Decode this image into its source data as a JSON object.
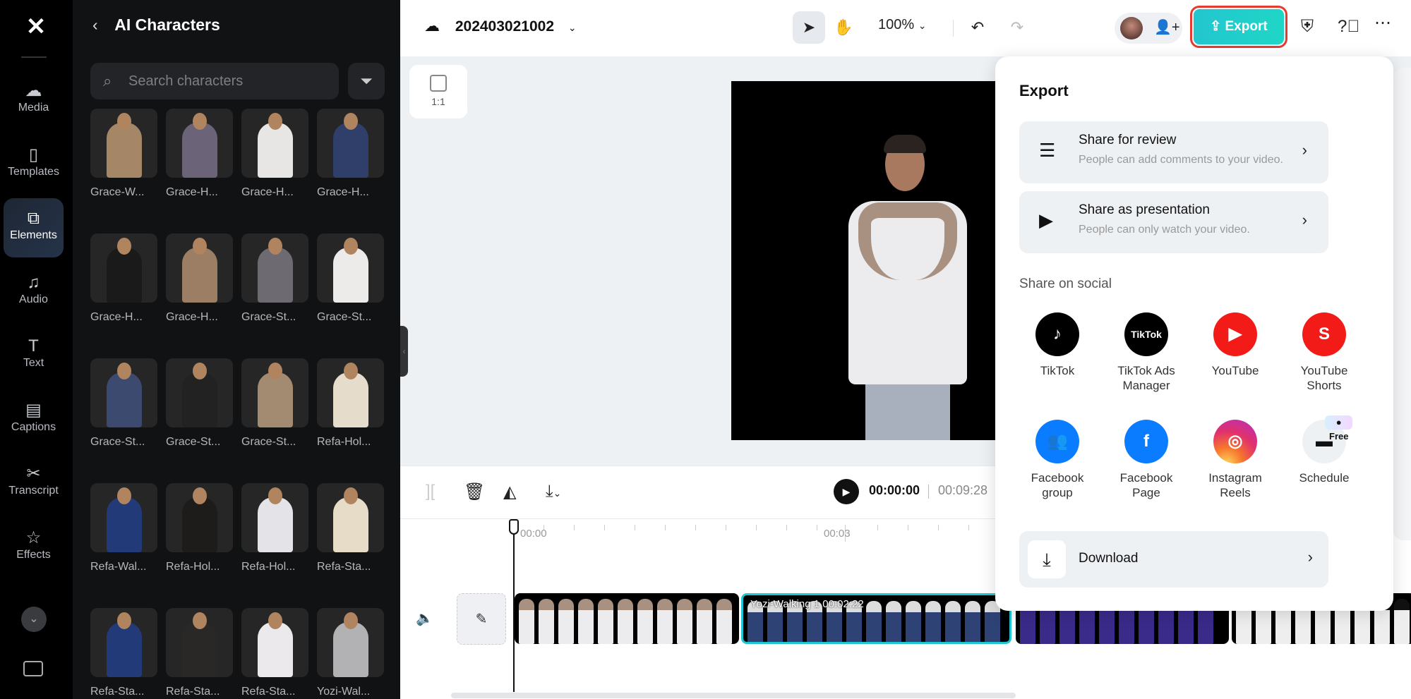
{
  "nav": {
    "logo": "capcut-logo",
    "items": [
      {
        "label": "Media",
        "icon": "cloud-upload-icon",
        "glyph": "☁",
        "active": false
      },
      {
        "label": "Templates",
        "icon": "templates-icon",
        "glyph": "▯",
        "active": false
      },
      {
        "label": "Elements",
        "icon": "elements-icon",
        "glyph": "⧉",
        "active": true
      },
      {
        "label": "Audio",
        "icon": "music-note-icon",
        "glyph": "♫",
        "active": false
      },
      {
        "label": "Text",
        "icon": "text-icon",
        "glyph": "T",
        "active": false
      },
      {
        "label": "Captions",
        "icon": "captions-icon",
        "glyph": "▤",
        "active": false
      },
      {
        "label": "Transcript",
        "icon": "transcript-icon",
        "glyph": "✂",
        "active": false
      },
      {
        "label": "Effects",
        "icon": "effects-star-icon",
        "glyph": "☆",
        "active": false
      }
    ],
    "more_glyph": "⌄"
  },
  "panel": {
    "back_glyph": "‹",
    "title": "AI Characters",
    "search_placeholder": "Search characters",
    "characters": [
      {
        "name": "Grace-W...",
        "color": "#a58768"
      },
      {
        "name": "Grace-H...",
        "color": "#6b6478"
      },
      {
        "name": "Grace-H...",
        "color": "#e8e6e4"
      },
      {
        "name": "Grace-H...",
        "color": "#2f3f6a"
      },
      {
        "name": "Grace-H...",
        "color": "#1a1a1a"
      },
      {
        "name": "Grace-H...",
        "color": "#9c7e64"
      },
      {
        "name": "Grace-St...",
        "color": "#6e6a72"
      },
      {
        "name": "Grace-St...",
        "color": "#ecebea"
      },
      {
        "name": "Grace-St...",
        "color": "#3d4a70"
      },
      {
        "name": "Grace-St...",
        "color": "#222222"
      },
      {
        "name": "Grace-St...",
        "color": "#a38b71"
      },
      {
        "name": "Refa-Hol...",
        "color": "#e6dccb"
      },
      {
        "name": "Refa-Wal...",
        "color": "#223a78"
      },
      {
        "name": "Refa-Hol...",
        "color": "#1e1c1b"
      },
      {
        "name": "Refa-Hol...",
        "color": "#e4e4e8"
      },
      {
        "name": "Refa-Sta...",
        "color": "#e7dcc8"
      },
      {
        "name": "Refa-Sta...",
        "color": "#223a78"
      },
      {
        "name": "Refa-Sta...",
        "color": "#2a2827"
      },
      {
        "name": "Refa-Sta...",
        "color": "#ebe9ec"
      },
      {
        "name": "Yozi-Wal...",
        "color": "#b2b2b4"
      }
    ]
  },
  "topbar": {
    "project_name": "202403021002",
    "zoom": "100%",
    "export_label": "Export",
    "export_color": "#22c6cf"
  },
  "canvas": {
    "ratio_label": "1:1"
  },
  "timeline": {
    "current_time": "00:00:00",
    "total_time": "00:09:28",
    "ruler_labels": [
      "00:00",
      "00:03"
    ],
    "clips": [
      {
        "label": "",
        "color": "#ecebee",
        "accent": "#a89180",
        "selected": false
      },
      {
        "label": "Yozi-Walking 1   00:02:22",
        "color": "#2e4276",
        "accent": "#ddd",
        "selected": true
      },
      {
        "label": "",
        "color": "#3a2a8a",
        "accent": "#333",
        "selected": false
      },
      {
        "label": "",
        "color": "#eeeeee",
        "accent": "#111",
        "selected": false
      }
    ]
  },
  "export_panel": {
    "title": "Export",
    "share_options": [
      {
        "title": "Share for review",
        "subtitle": "People can add comments to your video.",
        "icon": "comment-icon",
        "glyph": "☰"
      },
      {
        "title": "Share as presentation",
        "subtitle": "People can only watch your video.",
        "icon": "presentation-icon",
        "glyph": "▶"
      }
    ],
    "social_heading": "Share on social",
    "social": [
      {
        "label": "TikTok",
        "line2": "",
        "bg": "#000000",
        "glyph": "♪",
        "icon": "tiktok-icon"
      },
      {
        "label": "TikTok Ads",
        "line2": "Manager",
        "bg": "#000000",
        "glyph": "TikTok",
        "icon": "tiktok-business-icon"
      },
      {
        "label": "YouTube",
        "line2": "",
        "bg": "#f21b17",
        "glyph": "▶",
        "icon": "youtube-icon"
      },
      {
        "label": "YouTube",
        "line2": "Shorts",
        "bg": "#f21b17",
        "glyph": "S",
        "icon": "youtube-shorts-icon"
      },
      {
        "label": "Facebook",
        "line2": "group",
        "bg": "#0a7cff",
        "glyph": "👥",
        "icon": "facebook-group-icon"
      },
      {
        "label": "Facebook",
        "line2": "Page",
        "bg": "#0a7cff",
        "glyph": "f",
        "icon": "facebook-icon"
      },
      {
        "label": "Instagram",
        "line2": "Reels",
        "bg": "#e1306c",
        "glyph": "◎",
        "icon": "instagram-icon"
      },
      {
        "label": "Schedule",
        "line2": "",
        "bg": "#eef1f4",
        "glyph": "▬",
        "icon": "calendar-icon",
        "badge": "Free"
      }
    ],
    "download_label": "Download"
  }
}
